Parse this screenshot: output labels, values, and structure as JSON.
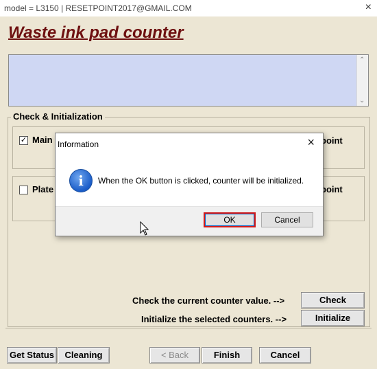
{
  "window": {
    "title": "model = L3150 | RESETPOINT2017@GMAIL.COM",
    "close_glyph": "×"
  },
  "heading": "Waste ink pad counter",
  "message_area": {
    "text": ""
  },
  "group": {
    "title": "Check & Initialization",
    "main_label": "Main",
    "main_checked": true,
    "main_right": "point",
    "platen_label": "Plate",
    "platen_checked": false,
    "platen_right": "point"
  },
  "actions": {
    "check_label": "Check the current counter value. -->",
    "check_button": "Check",
    "init_label": "Initialize the selected counters. -->",
    "init_button": "Initialize"
  },
  "footer": {
    "get_status": "Get Status",
    "cleaning": "Cleaning",
    "back": "< Back",
    "finish": "Finish",
    "cancel": "Cancel"
  },
  "dialog": {
    "title": "Information",
    "close_glyph": "×",
    "icon": "info-icon",
    "message": "When the OK button is clicked, counter will be initialized.",
    "ok": "OK",
    "cancel": "Cancel"
  },
  "colors": {
    "heading": "#6e1010",
    "message_area": "#cfd7f3",
    "ok_highlight": "#d11a1a"
  }
}
